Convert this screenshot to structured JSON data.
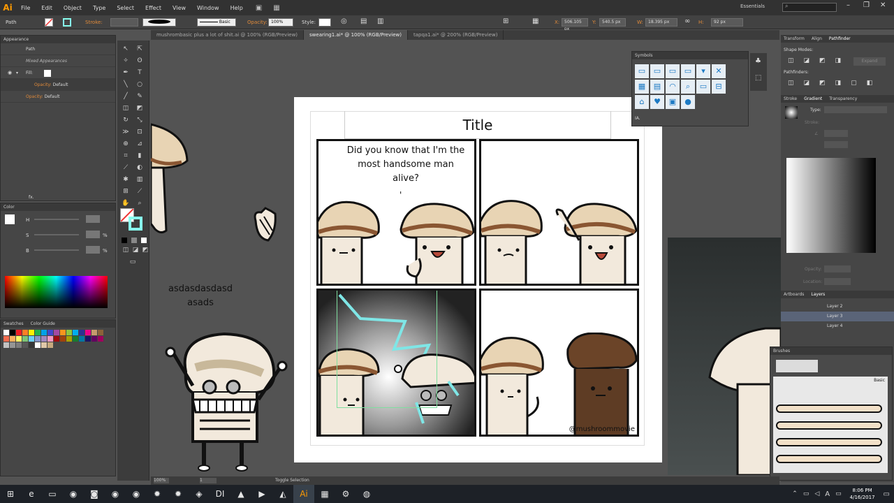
{
  "app": {
    "logo": "Ai",
    "menus": [
      "File",
      "Edit",
      "Object",
      "Type",
      "Select",
      "Effect",
      "View",
      "Window",
      "Help"
    ],
    "workspace": "Essentials",
    "search_placeholder": ""
  },
  "controlbar": {
    "selection_label": "Path",
    "stroke_label": "Stroke:",
    "brush_label": "Basic",
    "opacity_label": "Opacity:",
    "opacity_value": "100%",
    "style_label": "Style:",
    "x_label": "X:",
    "x_value": "506.105 px",
    "y_label": "Y:",
    "y_value": "540.5 px",
    "w_label": "W:",
    "w_value": "18.395 px",
    "h_label": "H:",
    "h_value": "92 px"
  },
  "tabs": [
    {
      "label": "mushrombasic plus a lot of shit.ai @ 100% (RGB/Preview)",
      "active": false
    },
    {
      "label": "swearing1.ai* @ 100% (RGB/Preview)",
      "active": true
    },
    {
      "label": "tapqa1.ai* @ 200% (RGB/Preview)",
      "active": false
    }
  ],
  "appearance": {
    "title": "Appearance",
    "path": "Path",
    "mixed": "Mixed Appearances",
    "fill": "Fill:",
    "opacity1_label": "Opacity:",
    "opacity1_value": "Default",
    "opacity2_label": "Opacity:",
    "opacity2_value": "Default",
    "fx": "fx."
  },
  "color_panel": {
    "title": "Color",
    "h": "H",
    "s": "S",
    "b": "B",
    "pct1": "°",
    "pct2": "%",
    "pct3": "%"
  },
  "swatches": {
    "title": "Swatches",
    "title2": "Color Guide",
    "colors": [
      "#ffffff",
      "#000000",
      "#ed1c24",
      "#ff7f27",
      "#fff200",
      "#22b14c",
      "#00a2e8",
      "#3f48cc",
      "#a349a4",
      "#f7941d",
      "#8dc63f",
      "#00aeef",
      "#2e3192",
      "#ec008c",
      "#c69c6d",
      "#8c6239",
      "#f26c4f",
      "#fbaf5d",
      "#fff568",
      "#7cc576",
      "#6dcff6",
      "#8393ca",
      "#a187be",
      "#f49ac2",
      "#9e0b0f",
      "#a0410d",
      "#aba000",
      "#197b30",
      "#0076a3",
      "#1b1464",
      "#630460",
      "#9e005d",
      "#c2c2c2",
      "#959595",
      "#7d7d7d",
      "#575757",
      "#363636",
      "#ffffff",
      "#e0c8a8",
      "#c7a97e"
    ]
  },
  "symbols": {
    "title": "Symbols",
    "footer": "IA."
  },
  "comic": {
    "title": "Title",
    "bubble": "Did you know that I'm the most handsome man alive?",
    "tick": "'",
    "credit": "@mushroommovie",
    "side_text": "asdasdasdasd\nasads"
  },
  "right": {
    "tabs1": [
      "Transform",
      "Align",
      "Pathfinder"
    ],
    "shape_modes": "Shape Modes:",
    "pathfinders": "Pathfinders:",
    "expand": "Expand",
    "tabs2": [
      "Stroke",
      "Gradient",
      "Transparency"
    ],
    "type_label": "Type:",
    "stroke_label": "Stroke:",
    "angle_label": "∠",
    "opacity_label": "Opacity:",
    "location_label": "Location:",
    "tabs3": [
      "Artboards",
      "Layers"
    ],
    "layers": [
      "Layer 2",
      "Layer 3",
      "Layer 4"
    ],
    "brushes_title": "Brushes",
    "brush_basic": "Basic"
  },
  "status": {
    "zoom": "100%",
    "page": "1",
    "toggle": "Toggle Selection"
  },
  "taskbar": {
    "time": "8:06 PM",
    "date": "4/16/2017",
    "lang": "A"
  }
}
